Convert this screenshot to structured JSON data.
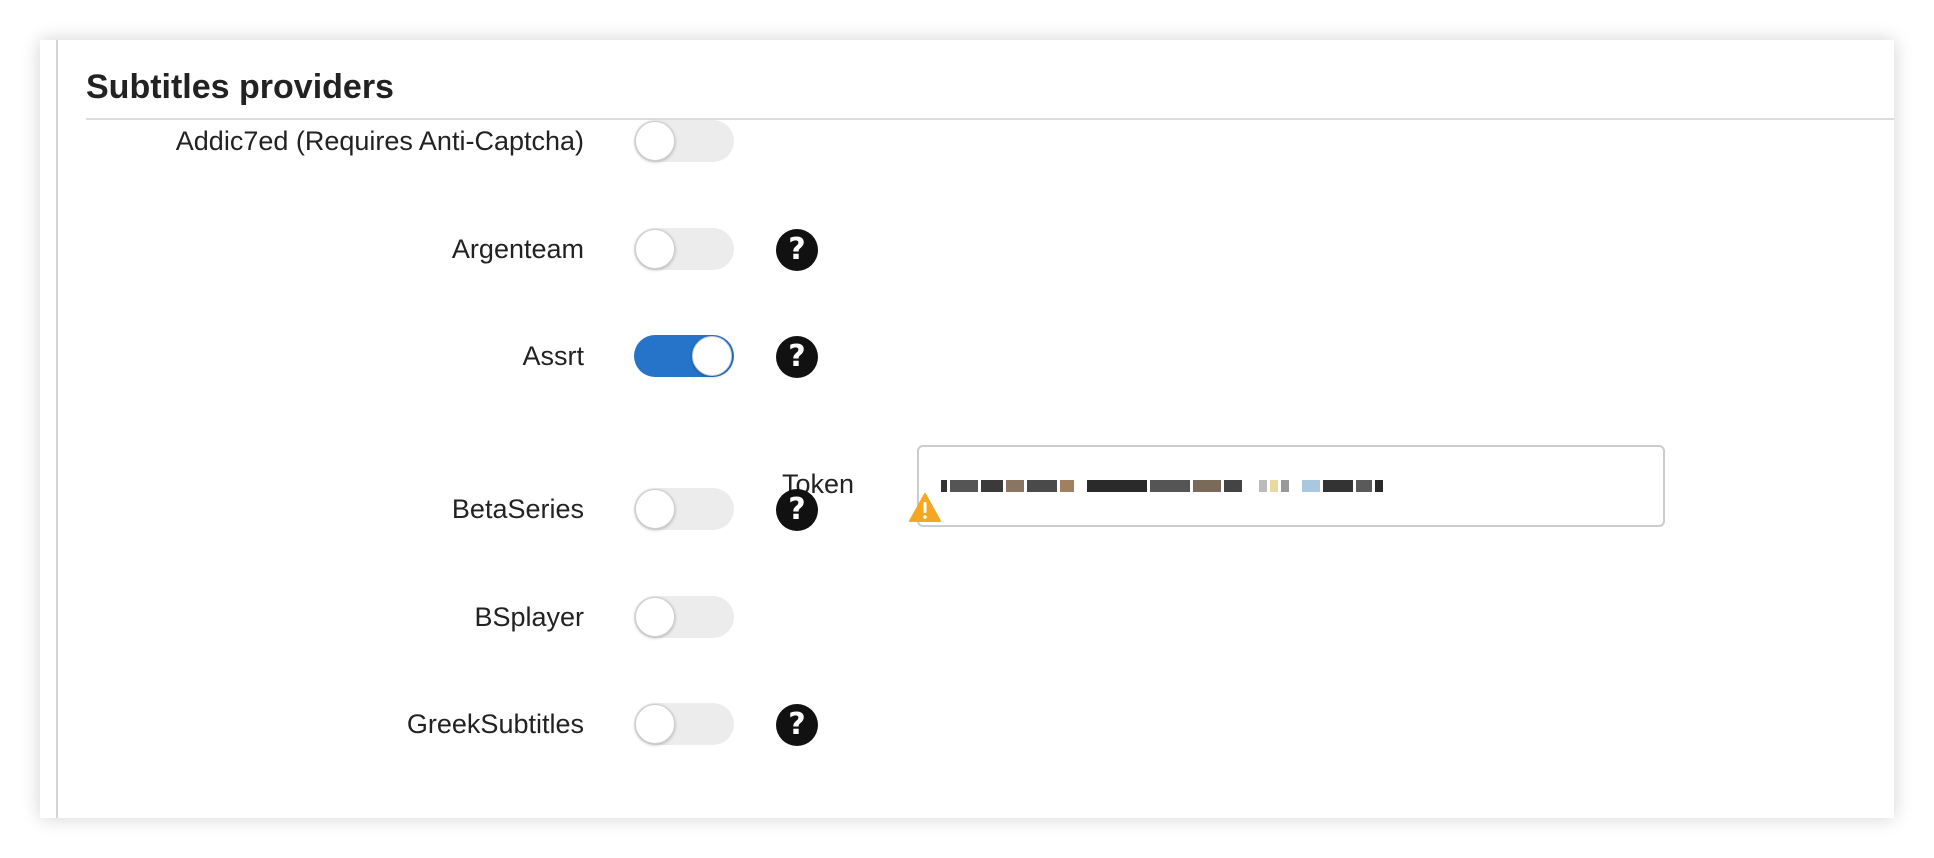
{
  "section": {
    "title": "Subtitles providers"
  },
  "providers": [
    {
      "label": "Addic7ed (Requires Anti-Captcha)",
      "enabled": false,
      "has_help": false,
      "has_warning": false
    },
    {
      "label": "Argenteam",
      "enabled": false,
      "has_help": true,
      "has_warning": false
    },
    {
      "label": "Assrt",
      "enabled": true,
      "has_help": true,
      "has_warning": false
    },
    {
      "label": "BetaSeries",
      "enabled": false,
      "has_help": true,
      "has_warning": true
    },
    {
      "label": "BSplayer",
      "enabled": false,
      "has_help": false,
      "has_warning": false
    },
    {
      "label": "GreekSubtitles",
      "enabled": false,
      "has_help": true,
      "has_warning": false
    }
  ],
  "assrt_settings": {
    "token_label": "Token",
    "token_value_redacted": true
  },
  "colors": {
    "toggle_on": "#2574c9",
    "toggle_off": "#ececec",
    "help_icon": "#111111",
    "warning_icon": "#f5a623"
  },
  "icons": {
    "help": "question-circle-icon",
    "warning": "warning-triangle-icon",
    "help_glyph": "?"
  }
}
